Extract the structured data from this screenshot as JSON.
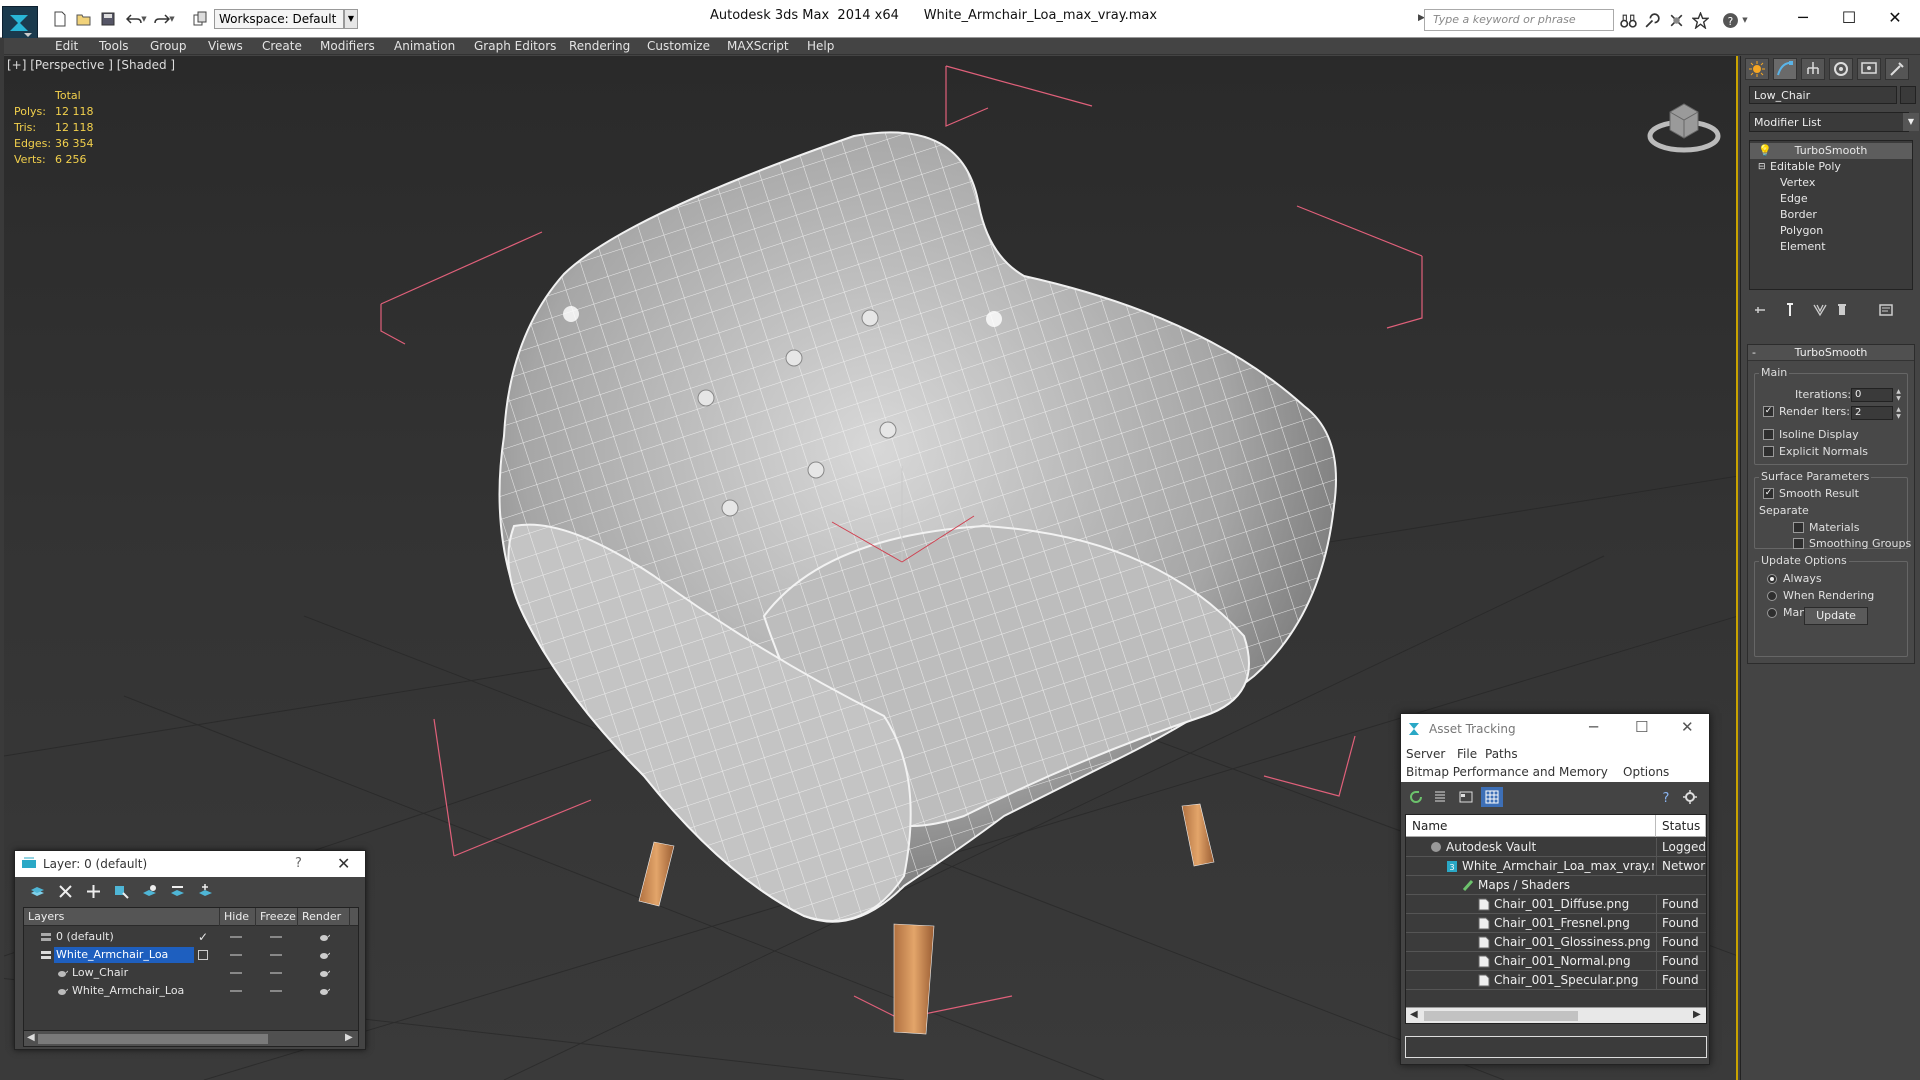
{
  "titlebar": {
    "workspace": "Workspace: Default",
    "app_title": "Autodesk 3ds Max  2014 x64",
    "file_title": "White_Armchair_Loa_max_vray.max",
    "search_placeholder": "Type a keyword or phrase"
  },
  "menu": [
    "Edit",
    "Tools",
    "Group",
    "Views",
    "Create",
    "Modifiers",
    "Animation",
    "Graph Editors",
    "Rendering",
    "Customize",
    "MAXScript",
    "Help"
  ],
  "viewport": {
    "label": "[+] [Perspective ] [Shaded ]",
    "stats": {
      "header": "Total",
      "rows": [
        {
          "label": "Polys:",
          "value": "12 118"
        },
        {
          "label": "Tris:",
          "value": "12 118"
        },
        {
          "label": "Edges:",
          "value": "36 354"
        },
        {
          "label": "Verts:",
          "value": "6 256"
        }
      ]
    }
  },
  "command_panel": {
    "object_name": "Low_Chair",
    "modifier_list": "Modifier List",
    "stack": [
      "TurboSmooth",
      "Editable Poly",
      "Vertex",
      "Edge",
      "Border",
      "Polygon",
      "Element"
    ],
    "turbosmooth": {
      "title": "TurboSmooth",
      "main_group": "Main",
      "iterations_label": "Iterations:",
      "iterations_value": "0",
      "render_iters_label": "Render Iters:",
      "render_iters_value": "2",
      "render_iters_checked": true,
      "isoline_label": "Isoline Display",
      "explicit_normals_label": "Explicit Normals",
      "surface_group": "Surface Parameters",
      "smooth_result_label": "Smooth Result",
      "smooth_result_checked": true,
      "separate_label": "Separate",
      "materials_label": "Materials",
      "smoothing_groups_label": "Smoothing Groups",
      "update_group": "Update Options",
      "always_label": "Always",
      "when_rendering_label": "When Rendering",
      "manually_label": "Manually",
      "update_button": "Update"
    }
  },
  "layer_window": {
    "title": "Layer: 0 (default)",
    "help": "?",
    "columns": [
      "Layers",
      "Hide",
      "Freeze",
      "Render"
    ],
    "rows": [
      {
        "name": "0 (default)",
        "indent": 0,
        "selected": false,
        "current": true
      },
      {
        "name": "White_Armchair_Loa",
        "indent": 0,
        "selected": true,
        "current": false
      },
      {
        "name": "Low_Chair",
        "indent": 1,
        "selected": false,
        "current": false
      },
      {
        "name": "White_Armchair_Loa",
        "indent": 1,
        "selected": false,
        "current": false
      }
    ]
  },
  "asset_window": {
    "title": "Asset Tracking",
    "menu_row1": [
      "Server",
      "File",
      "Paths"
    ],
    "menu_row2": [
      "Bitmap Performance and Memory",
      "Options"
    ],
    "columns": [
      "Name",
      "Status"
    ],
    "rows": [
      {
        "name": "Autodesk Vault",
        "status": "Logged Out",
        "indent": 1,
        "icon": "vault"
      },
      {
        "name": "White_Armchair_Loa_max_vray.max",
        "status": "Network",
        "indent": 2,
        "icon": "max"
      },
      {
        "name": "Maps / Shaders",
        "status": "",
        "indent": 3,
        "icon": "maps"
      },
      {
        "name": "Chair_001_Diffuse.png",
        "status": "Found",
        "indent": 4,
        "icon": "file"
      },
      {
        "name": "Chair_001_Fresnel.png",
        "status": "Found",
        "indent": 4,
        "icon": "file"
      },
      {
        "name": "Chair_001_Glossiness.png",
        "status": "Found",
        "indent": 4,
        "icon": "file"
      },
      {
        "name": "Chair_001_Normal.png",
        "status": "Found",
        "indent": 4,
        "icon": "file"
      },
      {
        "name": "Chair_001_Specular.png",
        "status": "Found",
        "indent": 4,
        "icon": "file"
      }
    ]
  },
  "colors": {
    "stats_text": "#f2d04c",
    "selection": "#1e5fbf",
    "bounding_box": "#e0607a",
    "viewport_border": "#c9a300",
    "chair_leg": "#d0915a"
  }
}
